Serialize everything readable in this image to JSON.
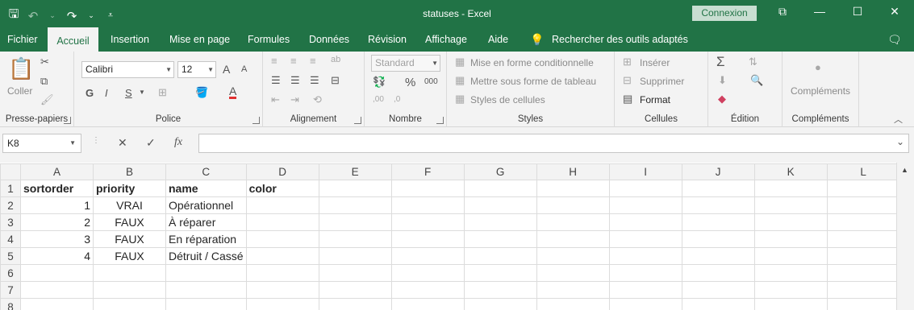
{
  "title_bar": {
    "doc_title": "statuses  -  Excel",
    "sign_in": "Connexion",
    "qat_icons": [
      "save-icon",
      "undo-icon",
      "redo-icon",
      "customize-qat-icon"
    ]
  },
  "tabs": [
    "Fichier",
    "Accueil",
    "Insertion",
    "Mise en page",
    "Formules",
    "Données",
    "Révision",
    "Affichage",
    "Aide"
  ],
  "active_tab": "Accueil",
  "tell_me": "Rechercher des outils adaptés",
  "ribbon": {
    "clipboard": {
      "label": "Presse-papiers",
      "paste": "Coller"
    },
    "font": {
      "label": "Police",
      "name": "Calibri",
      "size": "12",
      "bold": "G",
      "italic": "I",
      "underline": "S",
      "grow": "A",
      "shrink": "A",
      "color_letter": "A",
      "font_color": "#e03030"
    },
    "alignment": {
      "label": "Alignement"
    },
    "number": {
      "label": "Nombre",
      "format": "Standard",
      "percent": "%",
      "thousands": "000",
      "inc_decimal": ",00",
      "dec_decimal": ",0"
    },
    "styles": {
      "label": "Styles",
      "conditional": "Mise en forme conditionnelle",
      "table": "Mettre sous forme de tableau",
      "cell_styles": "Styles de cellules"
    },
    "cells": {
      "label": "Cellules",
      "insert": "Insérer",
      "delete": "Supprimer",
      "format": "Format"
    },
    "editing": {
      "label": "Édition"
    },
    "addins": {
      "label": "Compléments",
      "button": "Compléments"
    }
  },
  "formula_bar": {
    "name_box": "K8",
    "formula": "",
    "fx": "fx"
  },
  "grid": {
    "columns": [
      "A",
      "B",
      "C",
      "D",
      "E",
      "F",
      "G",
      "H",
      "I",
      "J",
      "K",
      "L"
    ],
    "rows": [
      {
        "n": "1",
        "cells": [
          "sortorder",
          "priority",
          "name",
          "color"
        ]
      },
      {
        "n": "2",
        "cells": [
          "1",
          "VRAI",
          "Opérationnel",
          ""
        ]
      },
      {
        "n": "3",
        "cells": [
          "2",
          "FAUX",
          "À réparer",
          ""
        ]
      },
      {
        "n": "4",
        "cells": [
          "3",
          "FAUX",
          "En réparation",
          ""
        ]
      },
      {
        "n": "5",
        "cells": [
          "4",
          "FAUX",
          "Détruit / Cassé",
          ""
        ]
      },
      {
        "n": "6",
        "cells": [
          "",
          "",
          "",
          ""
        ]
      },
      {
        "n": "7",
        "cells": [
          "",
          "",
          "",
          ""
        ]
      },
      {
        "n": "8",
        "cells": [
          "",
          "",
          "",
          ""
        ]
      }
    ]
  },
  "accent_color": "#217346"
}
